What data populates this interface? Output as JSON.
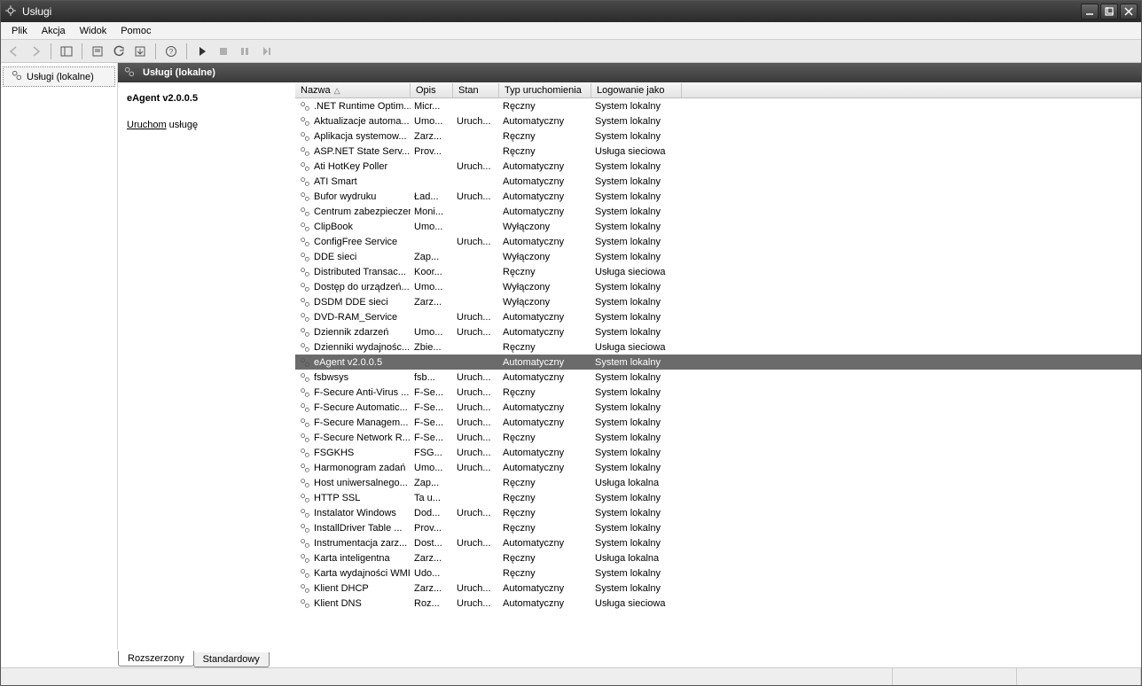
{
  "window": {
    "title": "Usługi"
  },
  "menu": {
    "items": [
      "Plik",
      "Akcja",
      "Widok",
      "Pomoc"
    ]
  },
  "tree": {
    "root": "Usługi (lokalne)"
  },
  "header": {
    "title": "Usługi (lokalne)"
  },
  "detail": {
    "selected_name": "eAgent v2.0.0.5",
    "action_link": "Uruchom",
    "action_rest": " usługę"
  },
  "columns": {
    "name": "Nazwa",
    "desc": "Opis",
    "status": "Stan",
    "start": "Typ uruchomienia",
    "logon": "Logowanie jako"
  },
  "rows": [
    {
      "name": ".NET Runtime Optim...",
      "desc": "Micr...",
      "status": "",
      "start": "Ręczny",
      "logon": "System lokalny"
    },
    {
      "name": "Aktualizacje automa...",
      "desc": "Umo...",
      "status": "Uruch...",
      "start": "Automatyczny",
      "logon": "System lokalny"
    },
    {
      "name": "Aplikacja systemow...",
      "desc": "Zarz...",
      "status": "",
      "start": "Ręczny",
      "logon": "System lokalny"
    },
    {
      "name": "ASP.NET State Serv...",
      "desc": "Prov...",
      "status": "",
      "start": "Ręczny",
      "logon": "Usługa sieciowa"
    },
    {
      "name": "Ati HotKey Poller",
      "desc": "",
      "status": "Uruch...",
      "start": "Automatyczny",
      "logon": "System lokalny"
    },
    {
      "name": "ATI Smart",
      "desc": "",
      "status": "",
      "start": "Automatyczny",
      "logon": "System lokalny"
    },
    {
      "name": "Bufor wydruku",
      "desc": "Ład...",
      "status": "Uruch...",
      "start": "Automatyczny",
      "logon": "System lokalny"
    },
    {
      "name": "Centrum zabezpieczeń",
      "desc": "Moni...",
      "status": "",
      "start": "Automatyczny",
      "logon": "System lokalny"
    },
    {
      "name": "ClipBook",
      "desc": "Umo...",
      "status": "",
      "start": "Wyłączony",
      "logon": "System lokalny"
    },
    {
      "name": "ConfigFree Service",
      "desc": "",
      "status": "Uruch...",
      "start": "Automatyczny",
      "logon": "System lokalny"
    },
    {
      "name": "DDE sieci",
      "desc": "Zap...",
      "status": "",
      "start": "Wyłączony",
      "logon": "System lokalny"
    },
    {
      "name": "Distributed Transac...",
      "desc": "Koor...",
      "status": "",
      "start": "Ręczny",
      "logon": "Usługa sieciowa"
    },
    {
      "name": "Dostęp do urządzeń...",
      "desc": "Umo...",
      "status": "",
      "start": "Wyłączony",
      "logon": "System lokalny"
    },
    {
      "name": "DSDM DDE sieci",
      "desc": "Zarz...",
      "status": "",
      "start": "Wyłączony",
      "logon": "System lokalny"
    },
    {
      "name": "DVD-RAM_Service",
      "desc": "",
      "status": "Uruch...",
      "start": "Automatyczny",
      "logon": "System lokalny"
    },
    {
      "name": "Dziennik zdarzeń",
      "desc": "Umo...",
      "status": "Uruch...",
      "start": "Automatyczny",
      "logon": "System lokalny"
    },
    {
      "name": "Dzienniki wydajnośc...",
      "desc": "Zbie...",
      "status": "",
      "start": "Ręczny",
      "logon": "Usługa sieciowa"
    },
    {
      "name": "eAgent v2.0.0.5",
      "desc": "",
      "status": "",
      "start": "Automatyczny",
      "logon": "System lokalny",
      "selected": true
    },
    {
      "name": "fsbwsys",
      "desc": "fsb...",
      "status": "Uruch...",
      "start": "Automatyczny",
      "logon": "System lokalny"
    },
    {
      "name": "F-Secure Anti-Virus ...",
      "desc": "F-Se...",
      "status": "Uruch...",
      "start": "Ręczny",
      "logon": "System lokalny"
    },
    {
      "name": "F-Secure Automatic...",
      "desc": "F-Se...",
      "status": "Uruch...",
      "start": "Automatyczny",
      "logon": "System lokalny"
    },
    {
      "name": "F-Secure Managem...",
      "desc": "F-Se...",
      "status": "Uruch...",
      "start": "Automatyczny",
      "logon": "System lokalny"
    },
    {
      "name": "F-Secure Network R...",
      "desc": "F-Se...",
      "status": "Uruch...",
      "start": "Ręczny",
      "logon": "System lokalny"
    },
    {
      "name": "FSGKHS",
      "desc": "FSG...",
      "status": "Uruch...",
      "start": "Automatyczny",
      "logon": "System lokalny"
    },
    {
      "name": "Harmonogram zadań",
      "desc": "Umo...",
      "status": "Uruch...",
      "start": "Automatyczny",
      "logon": "System lokalny"
    },
    {
      "name": "Host uniwersalnego...",
      "desc": "Zap...",
      "status": "",
      "start": "Ręczny",
      "logon": "Usługa lokalna"
    },
    {
      "name": "HTTP SSL",
      "desc": "Ta u...",
      "status": "",
      "start": "Ręczny",
      "logon": "System lokalny"
    },
    {
      "name": "Instalator Windows",
      "desc": "Dod...",
      "status": "Uruch...",
      "start": "Ręczny",
      "logon": "System lokalny"
    },
    {
      "name": "InstallDriver Table ...",
      "desc": "Prov...",
      "status": "",
      "start": "Ręczny",
      "logon": "System lokalny"
    },
    {
      "name": "Instrumentacja zarz...",
      "desc": "Dost...",
      "status": "Uruch...",
      "start": "Automatyczny",
      "logon": "System lokalny"
    },
    {
      "name": "Karta inteligentna",
      "desc": "Zarz...",
      "status": "",
      "start": "Ręczny",
      "logon": "Usługa lokalna"
    },
    {
      "name": "Karta wydajności WMI",
      "desc": "Udo...",
      "status": "",
      "start": "Ręczny",
      "logon": "System lokalny"
    },
    {
      "name": "Klient DHCP",
      "desc": "Zarz...",
      "status": "Uruch...",
      "start": "Automatyczny",
      "logon": "System lokalny"
    },
    {
      "name": "Klient DNS",
      "desc": "Roz...",
      "status": "Uruch...",
      "start": "Automatyczny",
      "logon": "Usługa sieciowa"
    }
  ],
  "tabs": {
    "extended": "Rozszerzony",
    "standard": "Standardowy"
  }
}
